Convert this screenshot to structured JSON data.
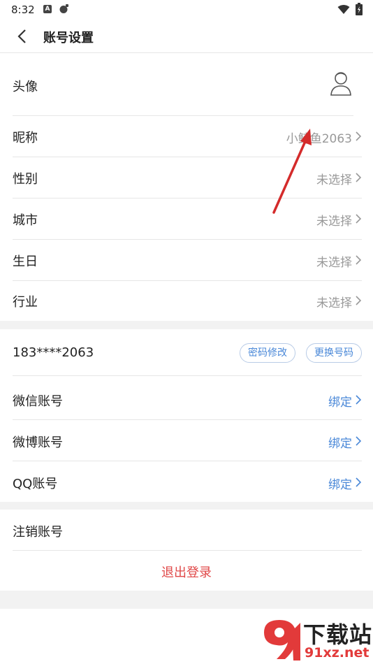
{
  "status_bar": {
    "time": "8:32",
    "a_badge": "A"
  },
  "header": {
    "title": "账号设置"
  },
  "profile": {
    "avatar_label": "头像",
    "nickname_label": "昵称",
    "nickname_value": "小鲸鱼2063",
    "gender_label": "性别",
    "gender_value": "未选择",
    "city_label": "城市",
    "city_value": "未选择",
    "birthday_label": "生日",
    "birthday_value": "未选择",
    "industry_label": "行业",
    "industry_value": "未选择"
  },
  "account": {
    "phone": "183****2063",
    "change_password": "密码修改",
    "change_phone": "更换号码",
    "wechat_label": "微信账号",
    "wechat_value": "绑定",
    "weibo_label": "微博账号",
    "weibo_value": "绑定",
    "qq_label": "QQ账号",
    "qq_value": "绑定"
  },
  "danger": {
    "cancel_account": "注销账号",
    "logout": "退出登录"
  },
  "watermark": {
    "title": "下载站",
    "domain": "91xz.net"
  },
  "colors": {
    "link_blue": "#4a88d8",
    "logout_red": "#e04848",
    "muted_gray": "#999999",
    "section_gap": "#f2f2f2"
  }
}
